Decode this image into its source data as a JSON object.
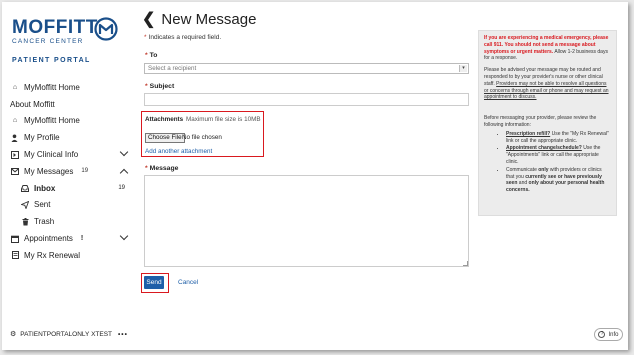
{
  "logo": {
    "word": "MOFFITT",
    "sub": "CANCER CENTER",
    "portal": "PATIENT PORTAL"
  },
  "nav": {
    "items": [
      {
        "label": "MyMoffitt Home"
      },
      {
        "label": "About Moffitt"
      },
      {
        "label": "MyMoffitt Home"
      },
      {
        "label": "My Profile"
      },
      {
        "label": "My Clinical Info"
      },
      {
        "label": "My Messages",
        "badge": "19"
      },
      {
        "label": "Inbox",
        "count": "19"
      },
      {
        "label": "Sent"
      },
      {
        "label": "Trash"
      },
      {
        "label": "Appointments",
        "badge": "!"
      },
      {
        "label": "My Rx Renewal"
      }
    ]
  },
  "user": {
    "name": "PATIENTPORTALONLY XTEST",
    "more": "•••"
  },
  "page": {
    "back": "❮",
    "title": "New Message",
    "required_note": "Indicates a required field."
  },
  "form": {
    "to_label": "To",
    "to_placeholder": "Select a recipient",
    "subject_label": "Subject",
    "subject_value": "",
    "attachments_label": "Attachments",
    "attachments_max": "Maximum file size is 10MB",
    "choose_file": "Choose File",
    "no_file": "No file chosen",
    "add_attachment": "Add another attachment",
    "message_label": "Message",
    "message_value": "",
    "send": "Send",
    "cancel": "Cancel"
  },
  "info": {
    "alert": "If you are experiencing a medical emergency, please call 911. You should not send a message about symptoms or urgent matters.",
    "alert_tail": "Allow 1-2 business days for a response.",
    "advise": "Please be advised your message may be routed and responded to by your provider's nurse or other clinical staff.",
    "advise_ul": "Providers may not be able to resolve all questions or concerns through email or phone and may request an appointment to discuss.",
    "before": "Before messaging your provider, please review the following information:",
    "b1_head": "Prescription refill?",
    "b1_tail": "Use the \"My Rx Renewal\" link or call the appropriate clinic.",
    "b2_head": "Appointment change/schedule?",
    "b2_tail": "Use the \"Appointments\" link or call the appropriate clinic.",
    "b3_a": "Communicate",
    "b3_b": "only",
    "b3_c": "with providers or clinics that you",
    "b3_d": "currently see or have previously seen",
    "b3_e": "and",
    "b3_f": "only about your personal health concerns."
  },
  "info_button": "Info",
  "colors": {
    "accent": "#1f5fa8",
    "brand": "#1a4f8a",
    "alert": "#d9191f"
  }
}
